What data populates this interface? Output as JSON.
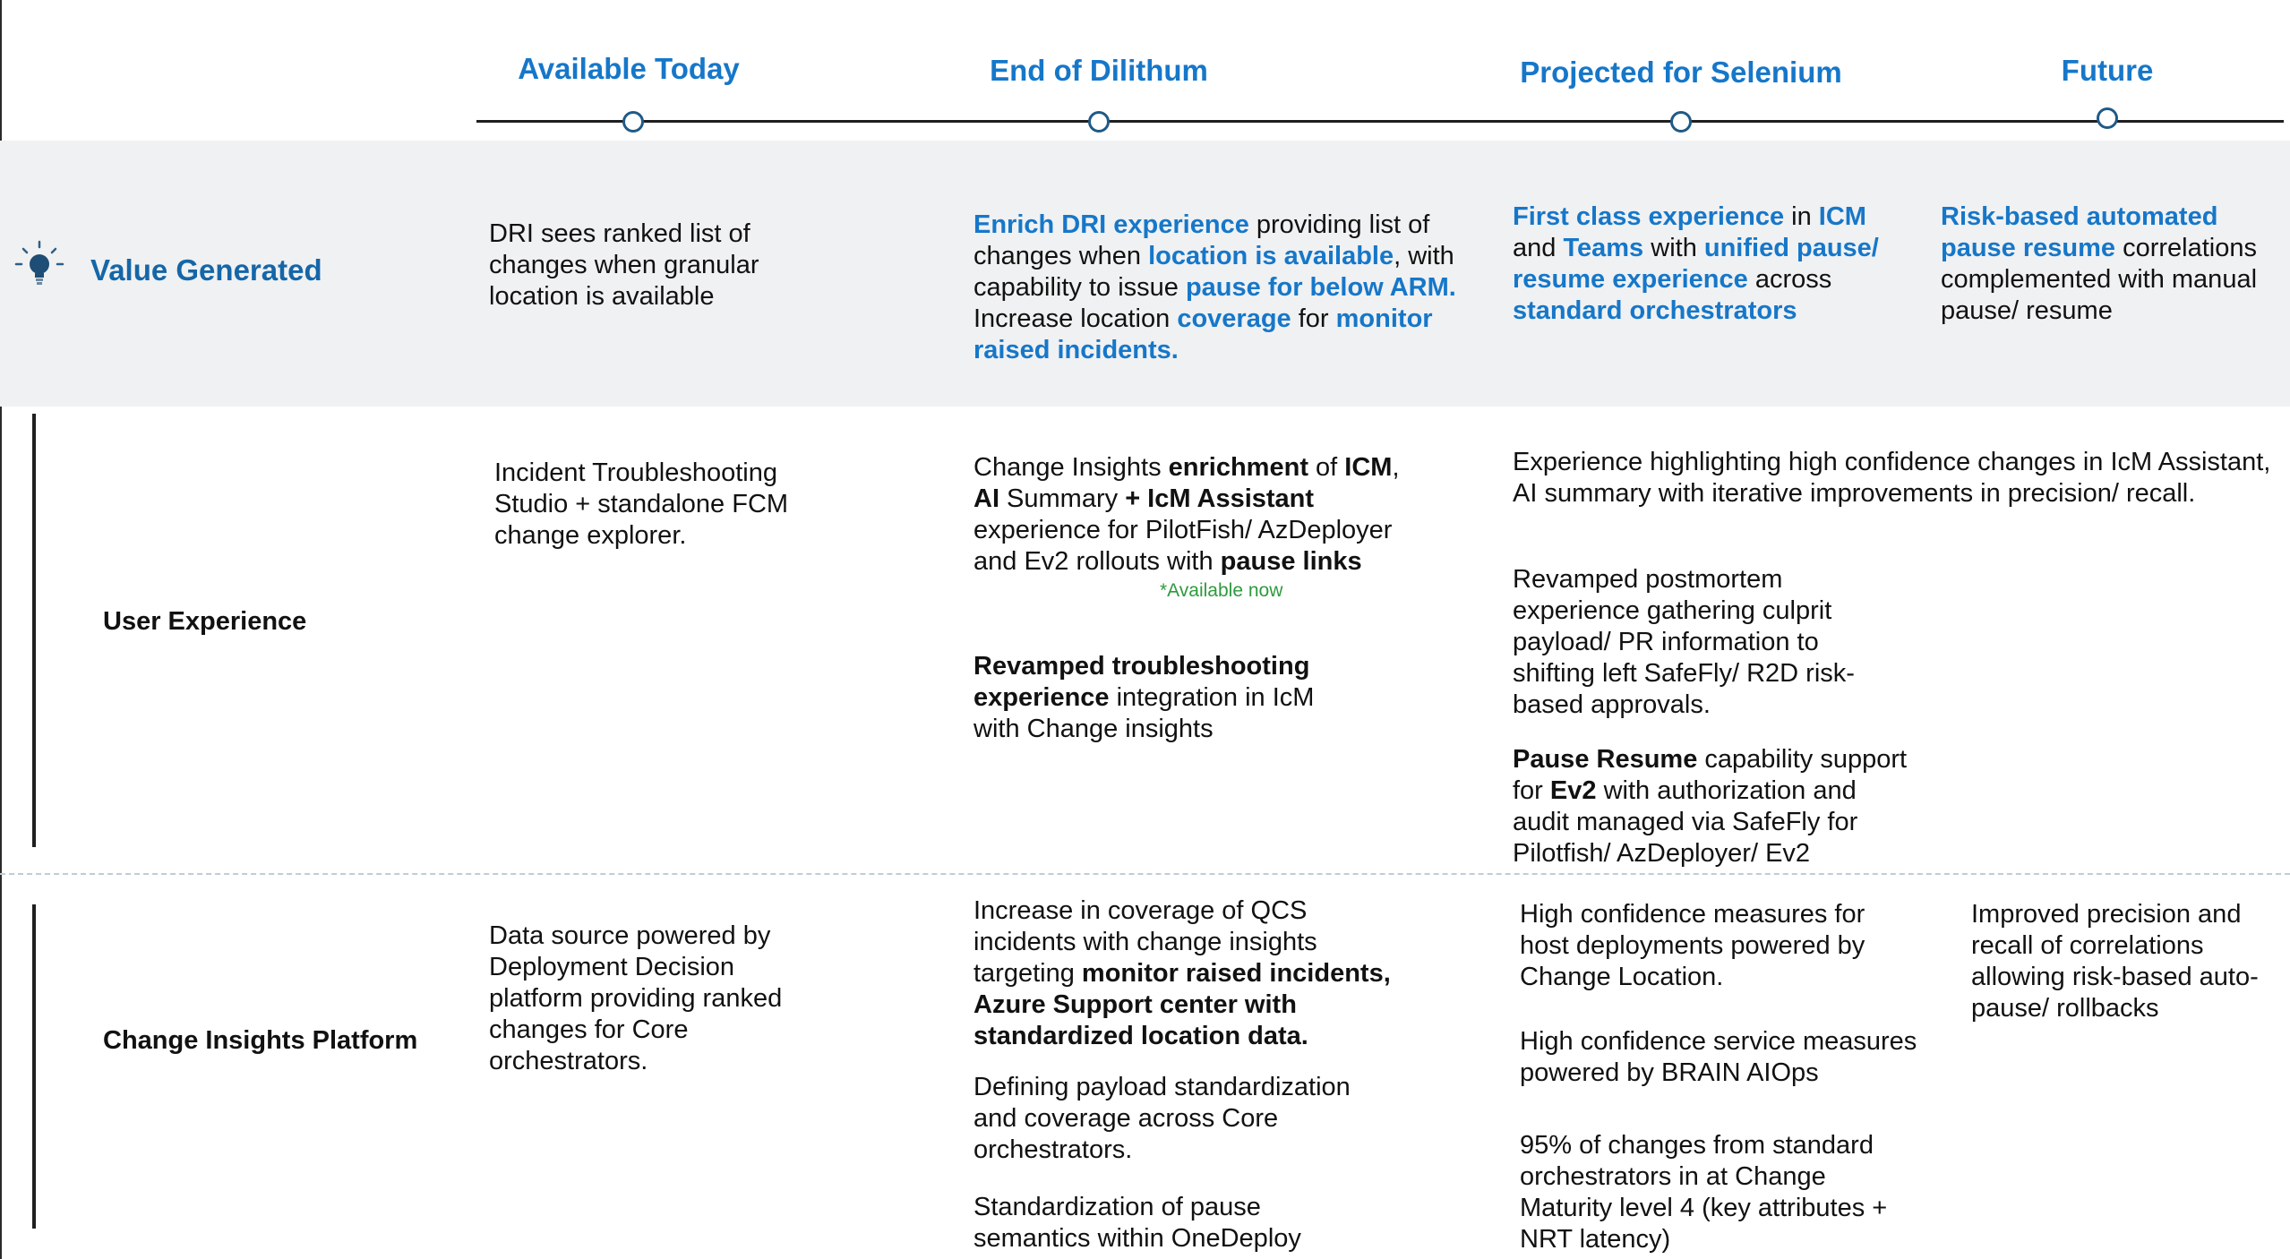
{
  "phases": {
    "available_today": "Available Today",
    "end_of_dilithum": "End of Dilithum",
    "projected_for_selenium": "Projected for Selenium",
    "future": "Future"
  },
  "rows": {
    "value_generated": "Value Generated",
    "user_experience": "User Experience",
    "change_insights_platform": "Change Insights Platform"
  },
  "value": {
    "today": "DRI sees ranked list of changes when granular location is available",
    "dilithum": {
      "t1": "Enrich DRI experience",
      "t2": " providing list of changes when ",
      "t3": "location is available",
      "t4": ", with capability to issue ",
      "t5": "pause for below ARM.",
      "t6": " Increase location ",
      "t7": "coverage",
      "t8": " for ",
      "t9": "monitor raised incidents."
    },
    "selenium": {
      "t1": "First class experience",
      "t2": " in ",
      "t3": "ICM",
      "t4": " and ",
      "t5": "Teams",
      "t6": " with ",
      "t7": "unified pause/ resume experience",
      "t8": " across ",
      "t9": "standard orchestrators"
    },
    "future": {
      "t1": "Risk-based automated pause resume",
      "t2": " correlations complemented with manual pause/ resume"
    }
  },
  "ux": {
    "today": "Incident Troubleshooting Studio + standalone FCM change explorer.",
    "dilithum_1": {
      "t1": "Change Insights ",
      "t2": "enrichment",
      "t3": " of ",
      "t4": "ICM",
      "t5": ", ",
      "t6": "AI",
      "t7": " Summary ",
      "t8": "+ IcM Assistant",
      "t9": " experience for PilotFish/ AzDeployer and Ev2 rollouts with ",
      "t10": "pause links"
    },
    "available_now": "*Available now",
    "dilithum_2": {
      "t1": "Revamped troubleshooting experience",
      "t2": " integration in IcM with Change insights"
    },
    "selenium_wide": "Experience highlighting high confidence changes in IcM Assistant, AI summary with iterative improvements in precision/ recall.",
    "selenium_2": "Revamped postmortem experience gathering culprit payload/ PR information to shifting left SafeFly/ R2D risk-based approvals.",
    "selenium_3": {
      "t1": "Pause Resume",
      "t2": " capability support for ",
      "t3": "Ev2",
      "t4": " with authorization and audit managed via SafeFly for Pilotfish/ AzDeployer/ Ev2"
    }
  },
  "platform": {
    "today": "Data source powered by Deployment Decision platform providing ranked changes for Core orchestrators.",
    "dilithum_1": {
      "t1": "Increase in coverage of QCS incidents with change insights targeting ",
      "t2": "monitor raised incidents, Azure Support center with standardized location data."
    },
    "dilithum_2": "Defining payload standardization and coverage across Core orchestrators.",
    "dilithum_3": "Standardization of pause semantics within OneDeploy",
    "selenium_1": "High confidence measures for host deployments powered by Change Location.",
    "selenium_2": "High confidence service measures powered by BRAIN AIOps",
    "selenium_3": "95% of changes from standard orchestrators in at Change Maturity level 4 (key attributes + NRT latency)",
    "future": "Improved precision and recall of correlations allowing risk-based auto-pause/ rollbacks"
  },
  "icons": {
    "value_icon": "lightbulb-icon"
  },
  "colors": {
    "accent": "#1677c9",
    "band": "#f0f1f2",
    "green": "#2e9a3d"
  }
}
